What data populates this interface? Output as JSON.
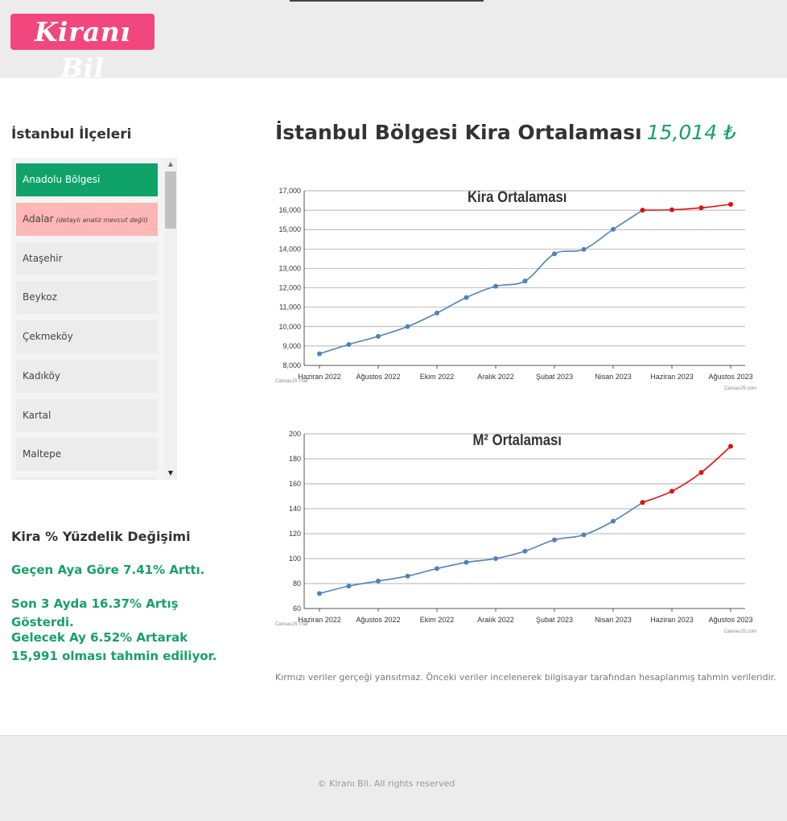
{
  "header": {
    "logo_text": "Kiranı Bil"
  },
  "sidebar": {
    "title": "İstanbul İlçeleri",
    "items": [
      {
        "label": "Anadolu Bölgesi",
        "note": "",
        "state": "active"
      },
      {
        "label": "Adalar",
        "note": "(detaylı analiz mevcut değil)",
        "state": "warn"
      },
      {
        "label": "Ataşehir",
        "note": "",
        "state": "normal"
      },
      {
        "label": "Beykoz",
        "note": "",
        "state": "normal"
      },
      {
        "label": "Çekmeköy",
        "note": "",
        "state": "normal"
      },
      {
        "label": "Kadıköy",
        "note": "",
        "state": "normal"
      },
      {
        "label": "Kartal",
        "note": "",
        "state": "normal"
      },
      {
        "label": "Maltepe",
        "note": "",
        "state": "normal"
      },
      {
        "label": "",
        "note": "",
        "state": "normal"
      }
    ]
  },
  "stats": {
    "title": "Kira % Yüzdelik Değişimi",
    "lines": [
      "Geçen Aya Göre 7.41% Arttı.",
      "Son 3 Ayda 16.37% Artış Gösterdi.",
      "Gelecek Ay 6.52% Artarak 15,991 olması tahmin ediliyor."
    ]
  },
  "main": {
    "title": "İstanbul Bölgesi Kira Ortalaması",
    "average": "15,014 ₺",
    "note": "Kırmızı veriler gerçeği yansıtmaz. Önceki veriler incelenerek bilgisayar tarafından hesaplanmış tahmin verileridir."
  },
  "footer": {
    "copyright": "© Kiranı Bil. All rights reserved"
  },
  "colors": {
    "accent": "#17a06a",
    "logo": "#f2467f",
    "actual": "#4f81bc",
    "forecast": "#e01010"
  },
  "chart_data": [
    {
      "type": "line",
      "title": "Kira Ortalaması",
      "x": [
        "Haziran 2022",
        "Temmuz 2022",
        "Ağustos 2022",
        "Eylül 2022",
        "Ekim 2022",
        "Kasım 2022",
        "Aralık 2022",
        "Ocak 2023",
        "Şubat 2023",
        "Mart 2023",
        "Nisan 2023",
        "Mayıs 2023",
        "Haziran 2023",
        "Temmuz 2023",
        "Ağustos 2023"
      ],
      "tick_labels": [
        "Haziran 2022",
        "Ağustos 2022",
        "Ekim 2022",
        "Aralık 2022",
        "Şubat 2023",
        "Nisan 2023",
        "Haziran 2023",
        "Ağustos 2023"
      ],
      "yticks": [
        "8,000",
        "9,000",
        "10,000",
        "11,000",
        "12,000",
        "13,000",
        "14,000",
        "15,000",
        "16,000",
        "17,000"
      ],
      "ylim": [
        8000,
        17000
      ],
      "series": [
        {
          "values": [
            8600,
            9080,
            9500,
            10000,
            10700,
            11500,
            12080,
            12350,
            13750,
            13980,
            15014,
            16000,
            null,
            null,
            null
          ],
          "color": "#4f81bc"
        },
        {
          "values": [
            null,
            null,
            null,
            null,
            null,
            null,
            null,
            null,
            null,
            null,
            null,
            16000,
            16020,
            16120,
            16300
          ],
          "color": "#e01010"
        }
      ],
      "credit_left": "CanvasJS Trial",
      "credit_right": "CanvasJS.com",
      "grid": true
    },
    {
      "type": "line",
      "title": "M² Ortalaması",
      "x": [
        "Haziran 2022",
        "Temmuz 2022",
        "Ağustos 2022",
        "Eylül 2022",
        "Ekim 2022",
        "Kasım 2022",
        "Aralık 2022",
        "Ocak 2023",
        "Şubat 2023",
        "Mart 2023",
        "Nisan 2023",
        "Mayıs 2023",
        "Haziran 2023",
        "Temmuz 2023",
        "Ağustos 2023"
      ],
      "tick_labels": [
        "Haziran 2022",
        "Ağustos 2022",
        "Ekim 2022",
        "Aralık 2022",
        "Şubat 2023",
        "Nisan 2023",
        "Haziran 2023",
        "Ağustos 2023"
      ],
      "yticks": [
        "60",
        "80",
        "100",
        "120",
        "140",
        "160",
        "180",
        "200"
      ],
      "ylim": [
        60,
        200
      ],
      "series": [
        {
          "values": [
            72,
            78,
            82,
            86,
            92,
            97,
            100,
            106,
            115,
            119,
            130,
            145,
            null,
            null,
            null
          ],
          "color": "#4f81bc"
        },
        {
          "values": [
            null,
            null,
            null,
            null,
            null,
            null,
            null,
            null,
            null,
            null,
            null,
            145,
            154,
            169,
            190
          ],
          "color": "#e01010"
        }
      ],
      "credit_left": "CanvasJS Trial",
      "credit_right": "CanvasJS.com",
      "grid": true
    }
  ]
}
